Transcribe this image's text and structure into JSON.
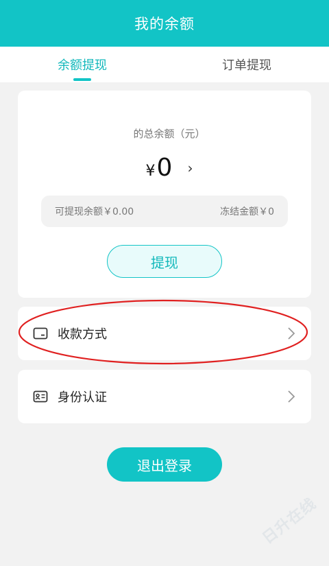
{
  "header": {
    "title": "我的余额"
  },
  "tabs": [
    {
      "label": "余额提现",
      "active": true
    },
    {
      "label": "订单提现",
      "active": false
    }
  ],
  "balance": {
    "total_label": "的总余额（元）",
    "currency_symbol": "¥",
    "total_amount": "0",
    "available_label": "可提现余额￥0.00",
    "frozen_label": "冻结金额￥0",
    "withdraw_label": "提现"
  },
  "menu": {
    "payment_method": {
      "label": "收款方式",
      "icon": "card-icon"
    },
    "identity_verify": {
      "label": "身份认证",
      "icon": "id-card-icon"
    }
  },
  "logout_label": "退出登录",
  "watermark": "日升在线",
  "colors": {
    "accent": "#12c4c6",
    "annotation": "#e02020"
  }
}
